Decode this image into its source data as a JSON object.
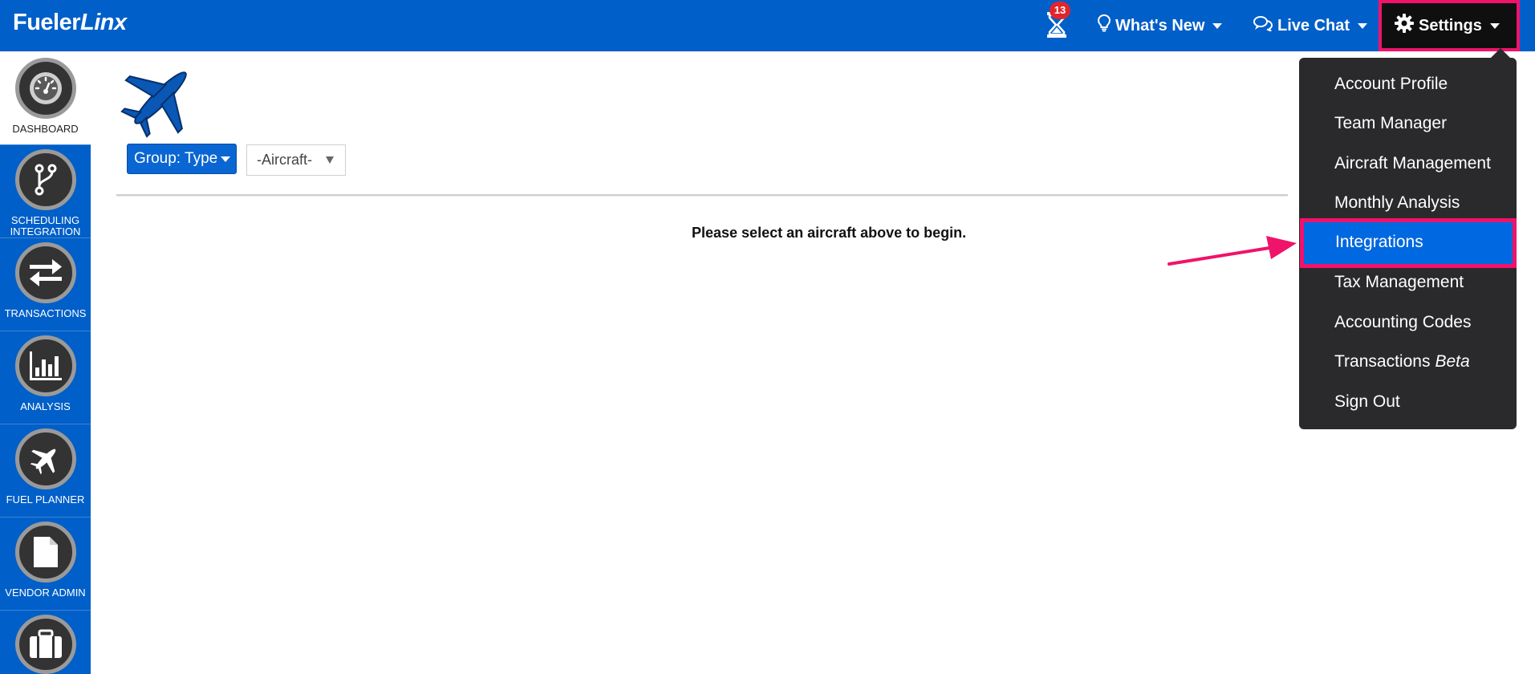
{
  "app": {
    "logo_part1": "Fueler",
    "logo_part2": "Linx"
  },
  "topnav": {
    "notifications_count": "13",
    "whats_new": "What's New",
    "live_chat": "Live Chat",
    "settings": "Settings"
  },
  "sidebar": {
    "items": [
      {
        "label": "DASHBOARD",
        "icon": "gauge-icon"
      },
      {
        "label": "SCHEDULING INTEGRATION",
        "icon": "branch-icon"
      },
      {
        "label": "TRANSACTIONS",
        "icon": "transfer-arrows-icon"
      },
      {
        "label": "ANALYSIS",
        "icon": "bar-chart-icon"
      },
      {
        "label": "FUEL PLANNER",
        "icon": "plane-icon"
      },
      {
        "label": "VENDOR ADMIN",
        "icon": "document-icon"
      },
      {
        "label": "",
        "icon": "briefcase-icon"
      }
    ]
  },
  "main": {
    "group_button": "Group: Type",
    "aircraft_select": "-Aircraft-",
    "empty_message": "Please select an aircraft above to begin."
  },
  "settings_menu": {
    "items": [
      {
        "label": "Account Profile"
      },
      {
        "label": "Team Manager"
      },
      {
        "label": "Aircraft Management"
      },
      {
        "label": "Monthly Analysis"
      },
      {
        "label": "Integrations",
        "highlighted": true
      },
      {
        "label": "Tax Management"
      },
      {
        "label": "Accounting Codes"
      },
      {
        "label": "Transactions",
        "suffix": "Beta"
      },
      {
        "label": "Sign Out"
      }
    ]
  },
  "colors": {
    "brand_blue": "#005fc8",
    "highlight_pink": "#f0136a",
    "menu_bg": "#2a2a2d",
    "menu_active": "#0068e0"
  }
}
